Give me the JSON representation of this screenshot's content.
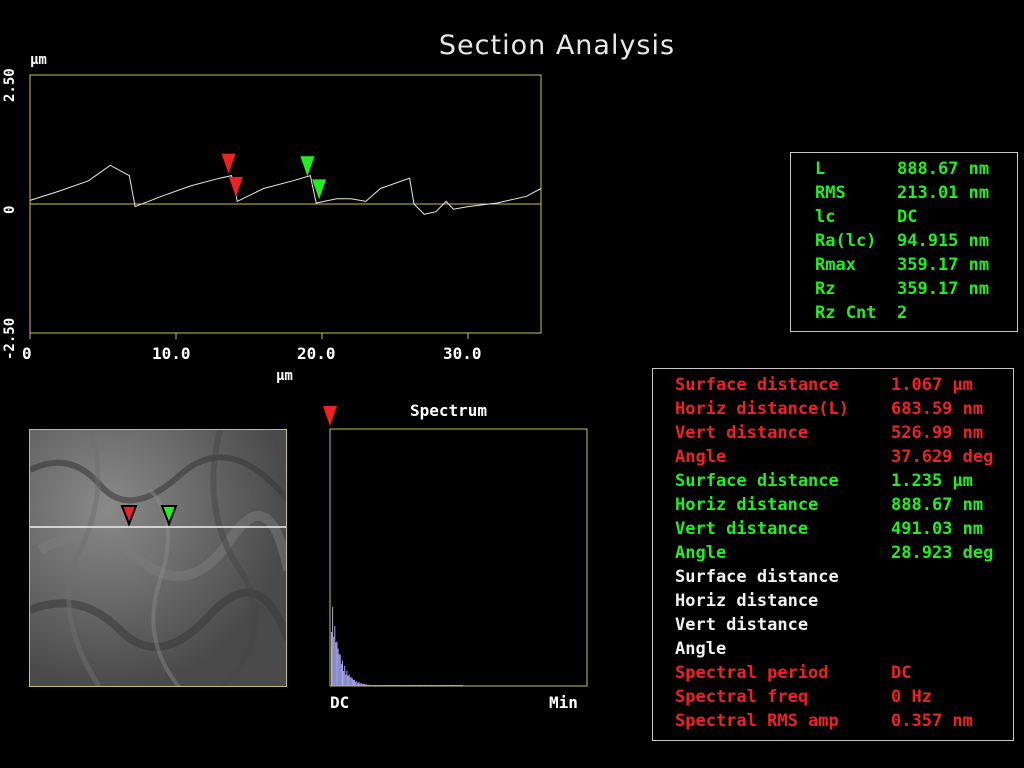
{
  "title": "Section Analysis",
  "profile": {
    "y_top": "2.50",
    "y_bottom": "-2.50",
    "y_zero": "0",
    "y_unit": "µm",
    "x_ticks": [
      "0",
      "10.0",
      "20.0",
      "30.0"
    ],
    "x_unit": "µm",
    "xlim": [
      0,
      35
    ],
    "ylim": [
      -2.5,
      2.5
    ],
    "profile_points": [
      [
        0,
        0.07
      ],
      [
        2,
        0.25
      ],
      [
        4,
        0.45
      ],
      [
        5.5,
        0.75
      ],
      [
        6.8,
        0.55
      ],
      [
        7.2,
        -0.05
      ],
      [
        9,
        0.15
      ],
      [
        11,
        0.35
      ],
      [
        13,
        0.5
      ],
      [
        13.8,
        0.55
      ],
      [
        14.2,
        0.05
      ],
      [
        16,
        0.3
      ],
      [
        18,
        0.45
      ],
      [
        19.2,
        0.55
      ],
      [
        19.6,
        0.02
      ],
      [
        21,
        0.1
      ],
      [
        22,
        0.1
      ],
      [
        23,
        0.05
      ],
      [
        24,
        0.3
      ],
      [
        26,
        0.5
      ],
      [
        26.3,
        0.0
      ],
      [
        27,
        -0.2
      ],
      [
        27.8,
        -0.15
      ],
      [
        28.5,
        0.05
      ],
      [
        29,
        -0.1
      ],
      [
        30,
        -0.05
      ],
      [
        32,
        0.02
      ],
      [
        34,
        0.15
      ],
      [
        35,
        0.3
      ]
    ],
    "markers": [
      {
        "color": "#ee2222",
        "x": 13.6,
        "y": 0.55
      },
      {
        "color": "#ee2222",
        "x": 14.1,
        "y": 0.1
      },
      {
        "color": "#22ee22",
        "x": 19.0,
        "y": 0.5
      },
      {
        "color": "#22ee22",
        "x": 19.8,
        "y": 0.05
      }
    ]
  },
  "roughness": {
    "items": [
      {
        "label": "L",
        "value": "888.67 nm"
      },
      {
        "label": "RMS",
        "value": "213.01 nm"
      },
      {
        "label": "lc",
        "value": "DC"
      },
      {
        "label": "Ra(lc)",
        "value": "94.915 nm"
      },
      {
        "label": "Rmax",
        "value": "359.17 nm"
      },
      {
        "label": "Rz",
        "value": "359.17 nm"
      },
      {
        "label": "Rz Cnt",
        "value": "2"
      }
    ]
  },
  "spectrum": {
    "title": "Spectrum",
    "left_label": "DC",
    "right_label": "Min"
  },
  "measurements": [
    {
      "label": "Surface distance",
      "value": "1.067 µm",
      "color": "red"
    },
    {
      "label": "Horiz distance(L)",
      "value": "683.59 nm",
      "color": "red"
    },
    {
      "label": "Vert distance",
      "value": "526.99 nm",
      "color": "red"
    },
    {
      "label": "Angle",
      "value": "37.629 deg",
      "color": "red"
    },
    {
      "label": "Surface distance",
      "value": "1.235 µm",
      "color": "green"
    },
    {
      "label": "Horiz distance",
      "value": "888.67 nm",
      "color": "green"
    },
    {
      "label": "Vert distance",
      "value": "491.03 nm",
      "color": "green"
    },
    {
      "label": "Angle",
      "value": "28.923 deg",
      "color": "green"
    },
    {
      "label": "Surface distance",
      "value": "",
      "color": "white"
    },
    {
      "label": "Horiz distance",
      "value": "",
      "color": "white"
    },
    {
      "label": "Vert distance",
      "value": "",
      "color": "white"
    },
    {
      "label": "Angle",
      "value": "",
      "color": "white"
    },
    {
      "label": "Spectral period",
      "value": "DC",
      "color": "red"
    },
    {
      "label": "Spectral freq",
      "value": "0 Hz",
      "color": "red"
    },
    {
      "label": "Spectral RMS amp",
      "value": "0.357 nm",
      "color": "red"
    }
  ]
}
